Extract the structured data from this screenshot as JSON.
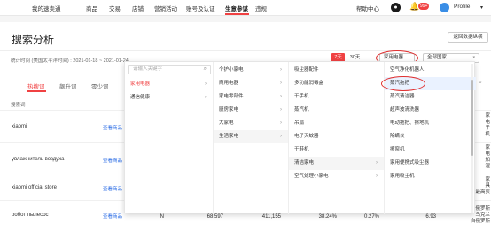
{
  "topnav": {
    "items": [
      "我的速卖通",
      "商品",
      "交易",
      "店铺",
      "营销活动",
      "账号及认证",
      "生意参谋",
      "违规"
    ],
    "help": "帮助中心",
    "badge": "99+",
    "profile": "Profile"
  },
  "page": {
    "title": "搜索分析",
    "help_button": "返回数据纵横",
    "stat_time": "统计时间 (美国太平洋时间) : 2021-01-18 ~ 2021-01-24",
    "range_7d": "7天",
    "range_30d": "30天",
    "category_select": "家用电器",
    "country_select": "全部国家"
  },
  "tabs": [
    "热搜词",
    "飙升词",
    "零少词"
  ],
  "table": {
    "header_search": "搜索词",
    "rows": [
      {
        "keyword": "xiaomi",
        "link": "查看商品",
        "side": [
          "家",
          "电",
          "手",
          "机"
        ]
      },
      {
        "keyword": "увлажнитель воздуха",
        "link": "查看商品",
        "side": [
          "家",
          "电",
          "加",
          "湿"
        ]
      },
      {
        "keyword": "xiaomi official store",
        "link": "查看商品",
        "side": [
          "家",
          "具",
          "最高页"
        ]
      },
      {
        "keyword": "робот пылесос",
        "link": "查看商品",
        "col_n": "N",
        "col_a": "68,597",
        "col_b": "411,155",
        "col_c": "38.24%",
        "col_d": "0.27%",
        "col_e": "6.93",
        "side": [
          "俄罗斯",
          "乌克兰",
          "白俄罗斯"
        ]
      }
    ]
  },
  "cascade": {
    "search_placeholder": "请输入关键字",
    "col1": [
      "家用电器",
      "通信健康"
    ],
    "col2": [
      "个护小家电",
      "商用电器",
      "家电零部件",
      "厨房家电",
      "大家电",
      "生活家电"
    ],
    "col3": [
      "吸尘器配件",
      "多功能消毒盒",
      "干手机",
      "蒸汽机",
      "吊扇",
      "电子灭蚊器",
      "干鞋机",
      "清洁家电",
      "空气处理小家电"
    ],
    "col4": [
      "空气净化机器人",
      "蒸汽拖把",
      "蒸汽清洁器",
      "超声波清洗器",
      "电动拖把、擦地机",
      "除螨仪",
      "擦窗机",
      "家用便携式吸尘器",
      "家用吸尘机"
    ]
  }
}
